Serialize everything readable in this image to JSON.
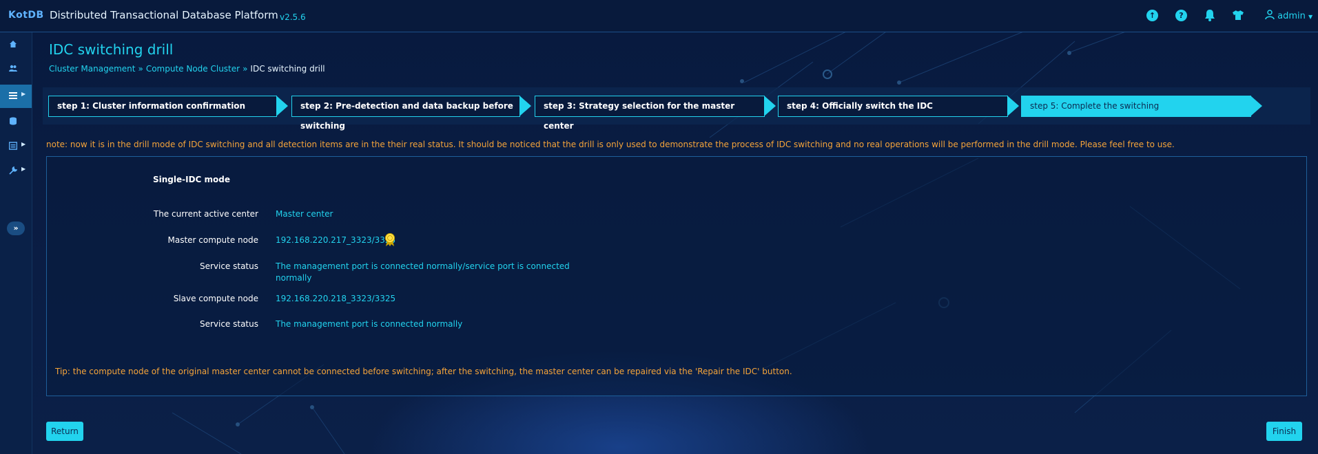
{
  "app": {
    "logo": "KotDB",
    "title": "Distributed Transactional Database Platform",
    "version": "v2.5.6",
    "user": "admin"
  },
  "header": {
    "icons": [
      "upload-icon",
      "help-icon",
      "bell-icon",
      "shirt-icon",
      "user-icon"
    ]
  },
  "sidebar": {
    "items": [
      {
        "icon": "home-icon",
        "expandable": false,
        "active": false
      },
      {
        "icon": "users-icon",
        "expandable": false,
        "active": false
      },
      {
        "icon": "list-icon",
        "expandable": true,
        "active": true
      },
      {
        "icon": "database-icon",
        "expandable": false,
        "active": false
      },
      {
        "icon": "panel-icon",
        "expandable": true,
        "active": false
      },
      {
        "icon": "wrench-icon",
        "expandable": true,
        "active": false
      }
    ],
    "expand_label": "»"
  },
  "page": {
    "title": "IDC switching drill",
    "breadcrumb": [
      {
        "label": "Cluster Management",
        "link": true
      },
      {
        "label": "Compute Node Cluster",
        "link": true
      },
      {
        "label": "IDC switching drill",
        "link": false
      }
    ],
    "breadcrumb_separator": "»"
  },
  "steps": [
    {
      "label": "step 1: Cluster information confirmation",
      "active": false
    },
    {
      "label": "step 2: Pre-detection and data backup before switching",
      "active": false
    },
    {
      "label": "step 3: Strategy selection for the master center",
      "active": false
    },
    {
      "label": "step 4: Officially switch the IDC",
      "active": false
    },
    {
      "label": "step 5: Complete the switching",
      "active": true
    }
  ],
  "note": "note: now it is in the drill mode of IDC switching and all detection items are in the their real status. It should be noticed that the drill is only used to demonstrate the process of IDC switching and no real operations will be performed in the drill mode. Please feel free to use.",
  "panel": {
    "mode_title": "Single-IDC mode",
    "rows": [
      {
        "label": "The current active center",
        "value": "Master center"
      },
      {
        "label": "Master compute node",
        "value": "192.168.220.217_3323/3325"
      },
      {
        "label": "Service status",
        "value_line1": "The management port is connected normally/service port is connected",
        "value_line2": "normally"
      },
      {
        "label": "Slave compute node",
        "value": "192.168.220.218_3323/3325"
      },
      {
        "label": "Service status",
        "value": "The management port is connected normally"
      }
    ],
    "tip": "Tip: the compute node of the original master center cannot be connected before switching; after the switching, the master center can be repaired via the 'Repair the IDC' button."
  },
  "buttons": {
    "return": "Return",
    "finish": "Finish"
  },
  "colors": {
    "accent": "#22d3ee",
    "warning": "#f5a43a",
    "background": "#07183a"
  }
}
